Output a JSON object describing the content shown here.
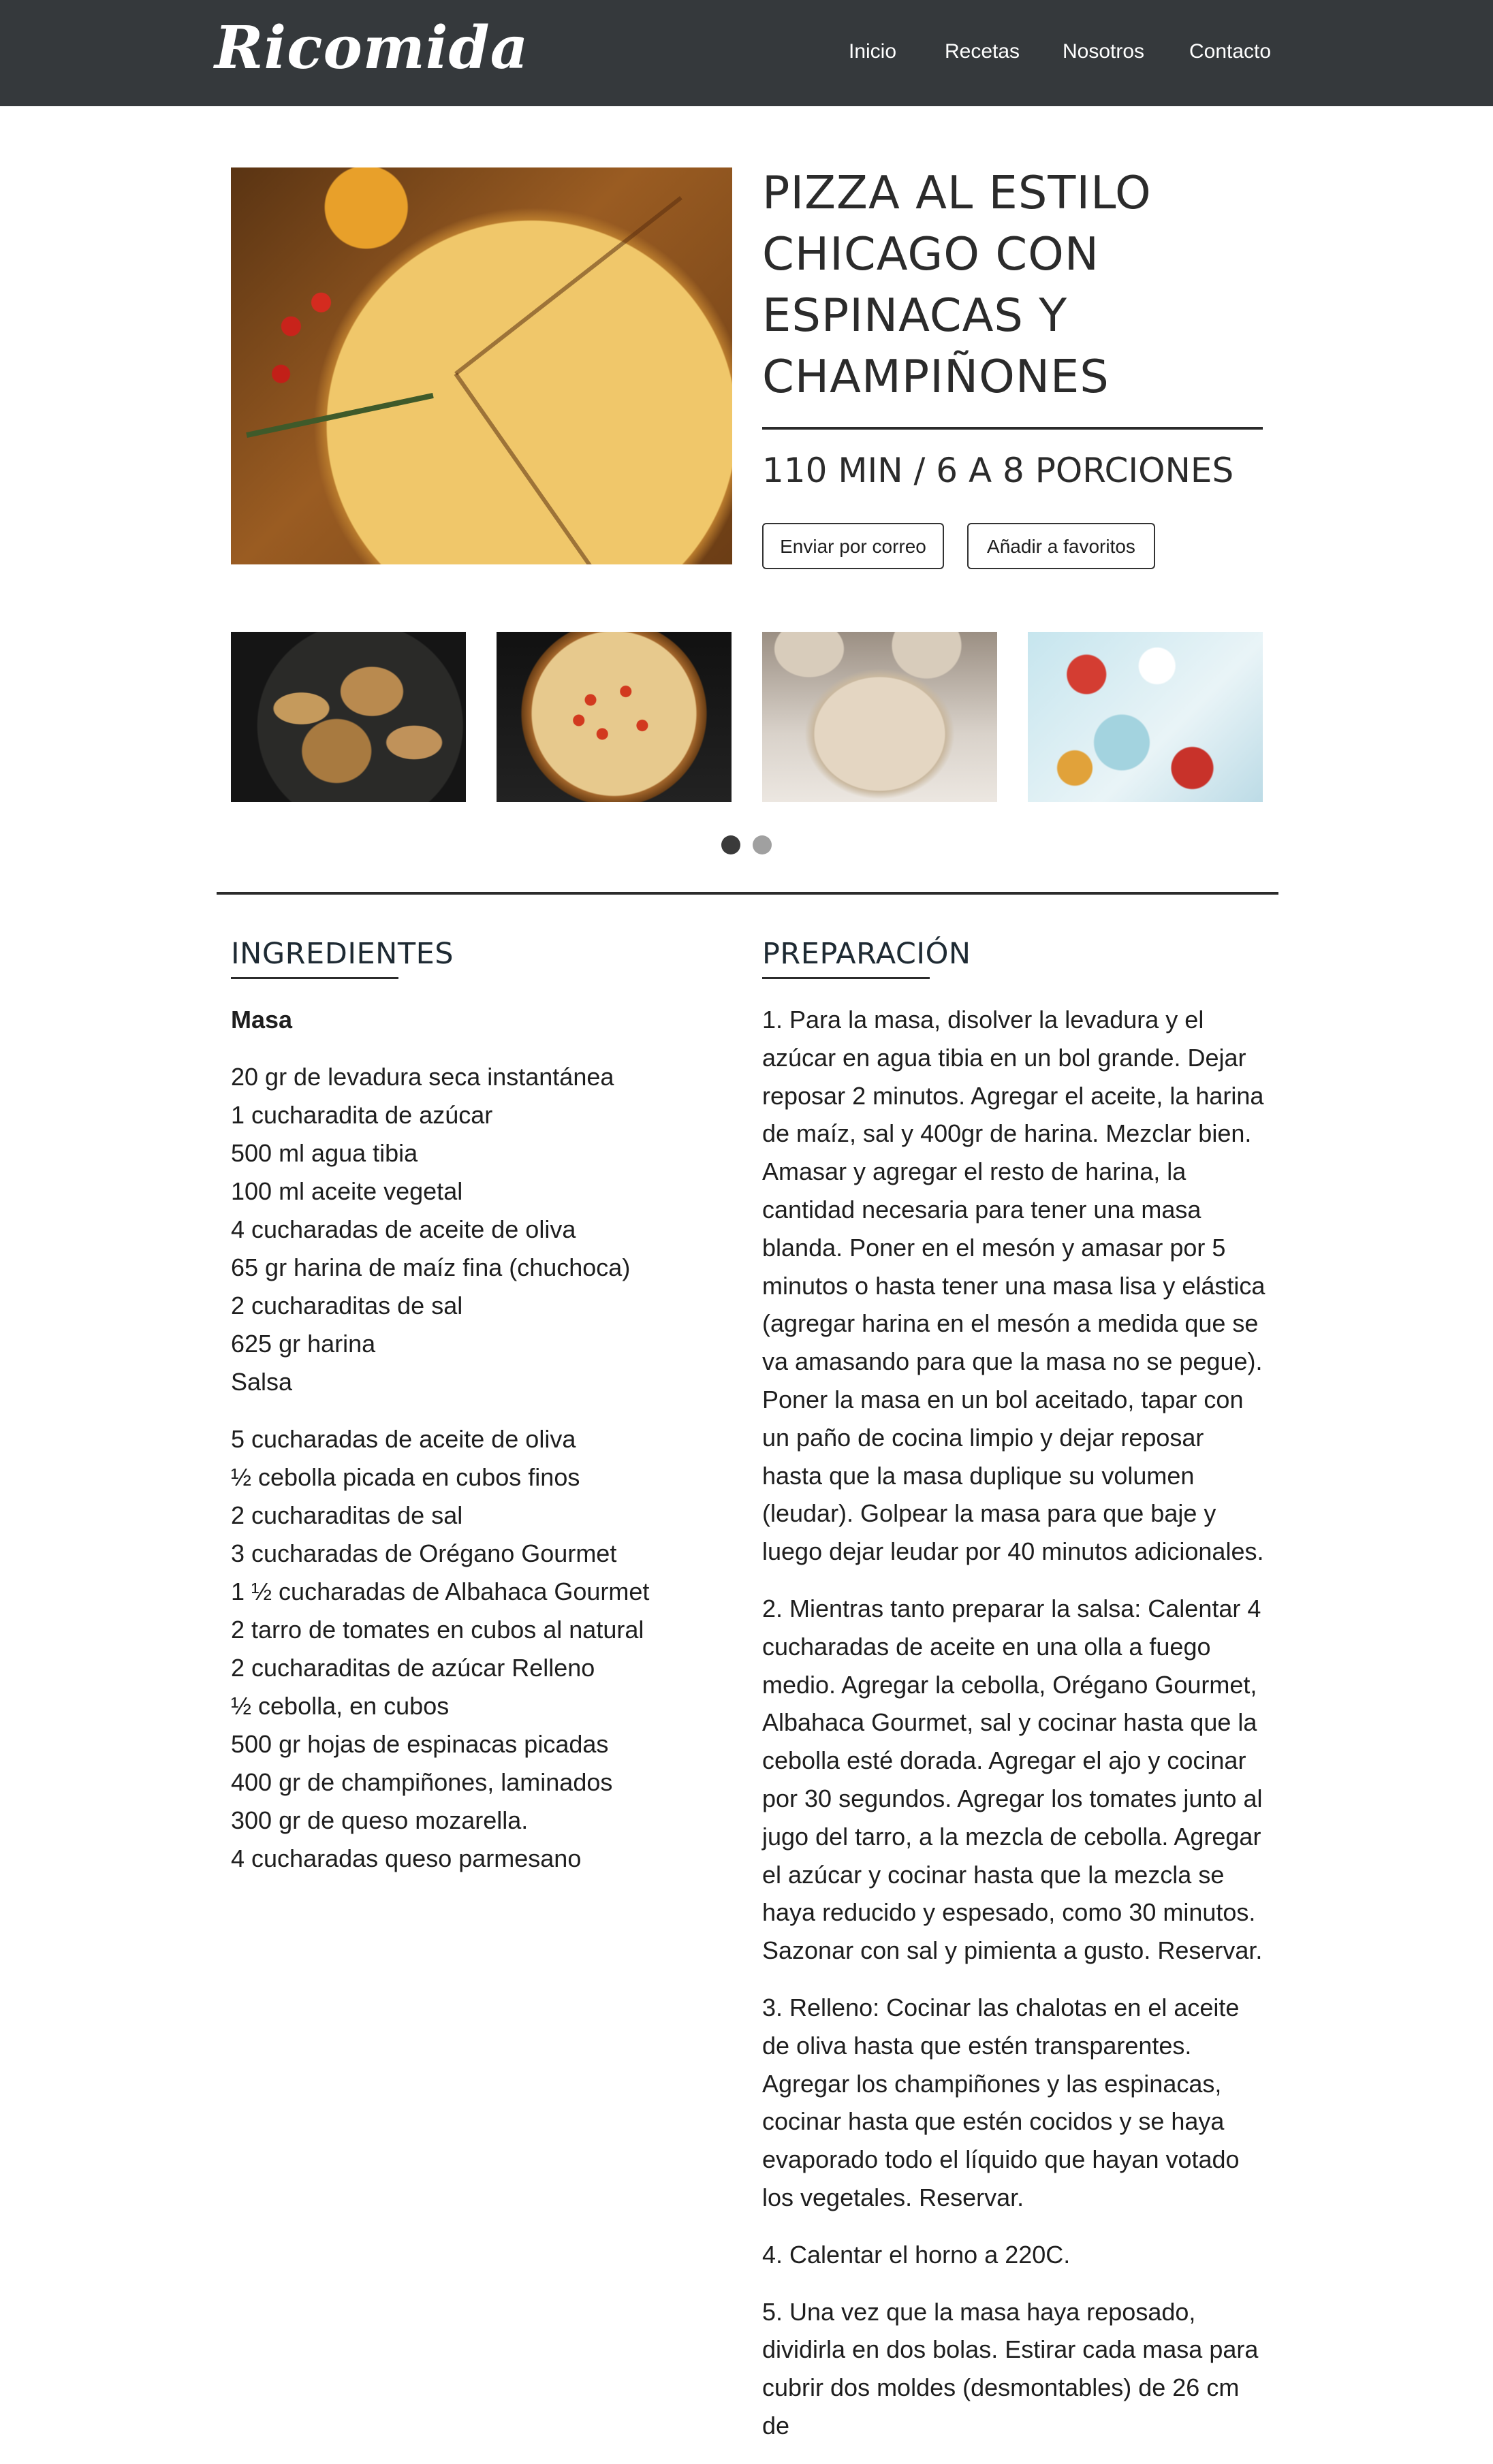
{
  "header": {
    "logo": "Ricomida",
    "nav": [
      "Inicio",
      "Recetas",
      "Nosotros",
      "Contacto"
    ]
  },
  "recipe": {
    "title": "PIZZA AL ESTILO CHICAGO CON ESPINACAS Y CHAMPIÑONES",
    "meta": "110 MIN / 6 A 8 PORCIONES",
    "buttons": {
      "email": "Enviar por correo",
      "favorite": "Añadir a favoritos"
    }
  },
  "gallery": {
    "images": [
      "pizza-photo",
      "mushrooms-photo",
      "baked-pizza-photo",
      "dough-photo",
      "toppings-photo"
    ],
    "pages": 2,
    "active_page": 1
  },
  "ingredients": {
    "heading": "INGREDIENTES",
    "masa_heading": "Masa",
    "masa": [
      "20 gr de levadura seca instantánea",
      "1 cucharadita de azúcar",
      "500 ml agua tibia",
      "100 ml aceite vegetal",
      "4 cucharadas de aceite de oliva",
      "65 gr harina de maíz fina (chuchoca)",
      "2 cucharaditas de sal",
      "625 gr harina",
      "Salsa"
    ],
    "salsa": [
      "5 cucharadas de aceite de oliva",
      "½ cebolla picada en cubos finos",
      "2 cucharaditas de sal",
      "3 cucharadas de Orégano Gourmet",
      "1 ½ cucharadas de Albahaca Gourmet",
      "2 tarro de tomates en cubos al natural",
      "2 cucharaditas de azúcar Relleno",
      "½ cebolla, en cubos",
      "500 gr hojas de espinacas picadas",
      "400 gr de champiñones, laminados",
      "300 gr de queso mozarella.",
      "4 cucharadas queso parmesano"
    ]
  },
  "preparation": {
    "heading": "PREPARACIÓN",
    "steps": [
      "1. Para la masa, disolver la levadura y el azúcar en agua tibia en un bol grande. Dejar reposar 2 minutos. Agregar el aceite, la harina de maíz, sal y 400gr de harina. Mezclar bien. Amasar y agregar el resto de harina, la cantidad necesaria para tener una masa blanda. Poner en el mesón y amasar por 5 minutos o hasta tener una masa lisa y elástica (agregar harina en el mesón a medida que se va amasando para que la masa no se pegue). Poner la masa en un bol aceitado, tapar con un paño de cocina limpio y dejar reposar hasta que la masa duplique su volumen (leudar). Golpear la masa para que baje y luego dejar leudar por 40 minutos adicionales.",
      "2. Mientras tanto preparar la salsa: Calentar 4 cucharadas de aceite en una olla a fuego medio. Agregar la cebolla, Orégano Gourmet, Albahaca Gourmet, sal y cocinar hasta que la cebolla esté dorada. Agregar el ajo y cocinar por 30 segundos. Agregar los tomates junto al jugo del tarro, a la mezcla de cebolla. Agregar el azúcar y cocinar hasta que la mezcla se haya reducido y espesado, como 30 minutos. Sazonar con sal y pimienta a gusto. Reservar.",
      "3. Relleno: Cocinar las chalotas en el aceite de oliva hasta que estén transparentes. Agregar los champiñones y las espinacas, cocinar hasta que estén cocidos y se haya evaporado todo el líquido que hayan votado los vegetales. Reservar.",
      "4. Calentar el horno a 220C.",
      "5. Una vez que la masa haya reposado, dividirla en dos bolas. Estirar cada masa para cubrir dos moldes (desmontables) de 26 cm de"
    ]
  }
}
